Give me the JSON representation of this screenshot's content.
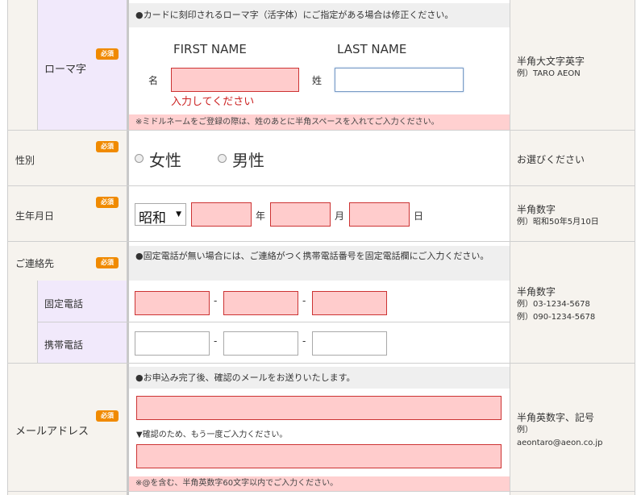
{
  "required_badge": "必須",
  "romaji": {
    "label": "ローマ字",
    "note": "●カードに刻印されるローマ字（活字体）にご指定がある場合は修正ください。",
    "first_name_header": "FIRST NAME",
    "last_name_header": "LAST NAME",
    "first_name_label": "名",
    "last_name_label": "姓",
    "error": "入力してください",
    "footer_note": "※ミドルネームをご登録の際は、姓のあとに半角スペースを入れてご入力ください。",
    "hint_line1": "半角大文字英字",
    "hint_line2": "例）TARO AEON"
  },
  "gender": {
    "label": "性別",
    "option_female": "女性",
    "option_male": "男性",
    "hint": "お選びください"
  },
  "birthdate": {
    "label": "生年月日",
    "era_value": "昭和",
    "year_unit": "年",
    "month_unit": "月",
    "day_unit": "日",
    "hint_line1": "半角数字",
    "hint_line2": "例）昭和50年5月10日"
  },
  "contact": {
    "label": "ご連絡先",
    "note": "●固定電話が無い場合には、ご連絡がつく携帯電話番号を固定電話欄にご入力ください。",
    "landline_label": "固定電話",
    "mobile_label": "携帯電話",
    "separator": "-",
    "hint_line1": "半角数字",
    "hint_line2": "例）03-1234-5678",
    "hint_line3": "例）090-1234-5678"
  },
  "email": {
    "label": "メールアドレス",
    "note": "●お申込み完了後、確認のメールをお送りいたします。",
    "confirm_note": "▼確認のため、もう一度ご入力ください。",
    "footer_note": "※@を含む、半角英数字60文字以内でご入力ください。",
    "hint_line1": "半角英数字、記号",
    "hint_line2": "例）",
    "hint_line3": "aeontaro@aeon.co.jp"
  }
}
